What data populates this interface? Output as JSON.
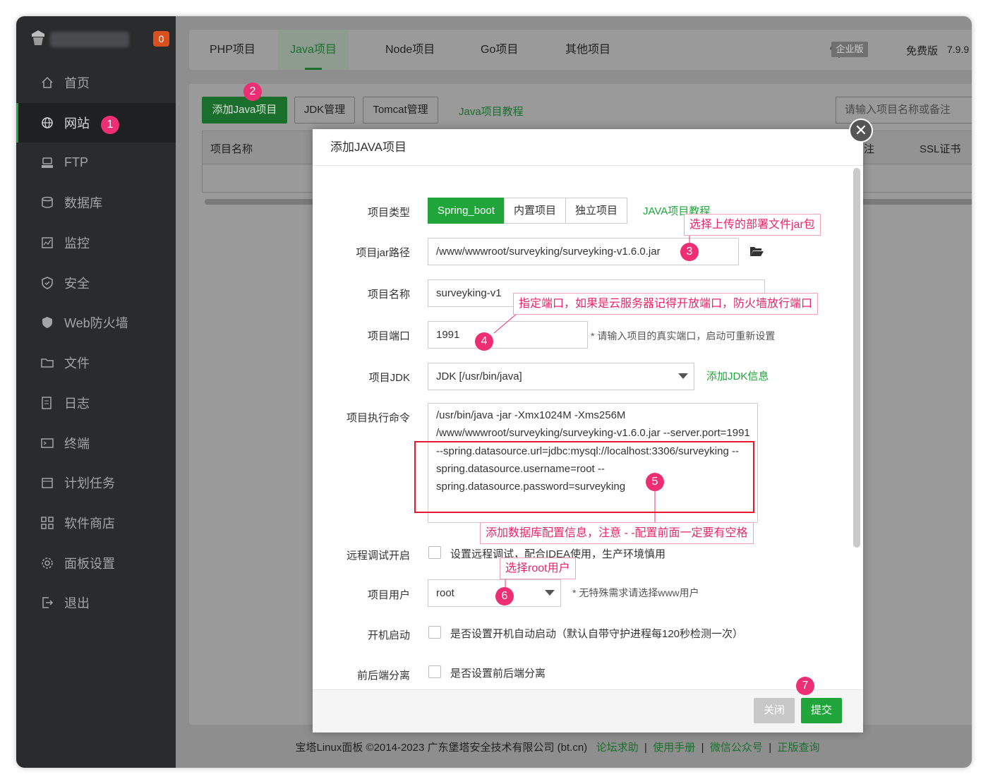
{
  "badge_count": "0",
  "sidebar": {
    "items": [
      {
        "label": "首页",
        "icon": "home-icon"
      },
      {
        "label": "网站",
        "icon": "globe-icon"
      },
      {
        "label": "FTP",
        "icon": "ftp-icon"
      },
      {
        "label": "数据库",
        "icon": "database-icon"
      },
      {
        "label": "监控",
        "icon": "monitor-icon"
      },
      {
        "label": "安全",
        "icon": "shield-icon"
      },
      {
        "label": "Web防火墙",
        "icon": "firewall-icon"
      },
      {
        "label": "文件",
        "icon": "folder-icon"
      },
      {
        "label": "日志",
        "icon": "log-icon"
      },
      {
        "label": "终端",
        "icon": "terminal-icon"
      },
      {
        "label": "计划任务",
        "icon": "calendar-icon"
      },
      {
        "label": "软件商店",
        "icon": "grid-icon"
      },
      {
        "label": "面板设置",
        "icon": "settings-icon"
      },
      {
        "label": "退出",
        "icon": "logout-icon"
      }
    ]
  },
  "tabs": [
    "PHP项目",
    "Java项目",
    "Node项目",
    "Go项目",
    "其他项目"
  ],
  "header": {
    "enterprise": "企业版",
    "free": "免费版",
    "version": "7.9.9"
  },
  "toolbar": {
    "add_java": "添加Java项目",
    "jdk": "JDK管理",
    "tomcat": "Tomcat管理",
    "tutorial": "Java项目教程",
    "search_placeholder": "请输入项目名称或备注"
  },
  "table": {
    "col_name": "项目名称",
    "col_partial": "注",
    "col_ssl": "SSL证书"
  },
  "modal": {
    "title": "添加JAVA项目",
    "labels": {
      "type": "项目类型",
      "jar": "项目jar路径",
      "name": "项目名称",
      "port": "项目端口",
      "jdk": "项目JDK",
      "cmd": "项目执行命令",
      "debug": "远程调试开启",
      "user": "项目用户",
      "boot": "开机启动",
      "split": "前后端分离"
    },
    "type_options": [
      "Spring_boot",
      "内置项目",
      "独立项目"
    ],
    "type_tutorial": "JAVA项目教程",
    "jar_path": "/www/wwwroot/surveyking/surveyking-v1.6.0.jar",
    "name": "surveyking-v1",
    "port": "1991",
    "port_hint": "* 请输入项目的真实端口，启动可重新设置",
    "jdk": "JDK [/usr/bin/java]",
    "add_jdk": "添加JDK信息",
    "cmd": "/usr/bin/java -jar -Xmx1024M -Xms256M\n/www/wwwroot/surveyking/surveyking-v1.6.0.jar --server.port=1991\n--spring.datasource.url=jdbc:mysql://localhost:3306/surveyking --\nspring.datasource.username=root --\nspring.datasource.password=surveyking",
    "debug_text": "设置远程调试，配合IDEA使用，生产环境慎用",
    "user": "root",
    "user_hint": "* 无特殊需求请选择www用户",
    "boot_text": "是否设置开机自动启动（默认自带守护进程每120秒检测一次）",
    "split_text": "是否设置前后端分离",
    "close_btn": "关闭",
    "submit_btn": "提交"
  },
  "annotations": {
    "callout_jar": "选择上传的部署文件jar包",
    "callout_port": "指定端口，如果是云服务器记得开放端口，防火墙放行端口",
    "callout_db": "添加数据库配置信息，注意 - -配置前面一定要有空格",
    "callout_user": "选择root用户",
    "n1": "1",
    "n2": "2",
    "n3": "3",
    "n4": "4",
    "n5": "5",
    "n6": "6",
    "n7": "7"
  },
  "footer": {
    "copyright": "宝塔Linux面板 ©2014-2023 广东堡塔安全技术有限公司 (bt.cn)",
    "links": [
      "论坛求助",
      "使用手册",
      "微信公众号",
      "正版查询"
    ]
  },
  "colors": {
    "accent": "#20a53a",
    "annotation": "#ee2e72",
    "sidebar": "#2a2b2d"
  }
}
